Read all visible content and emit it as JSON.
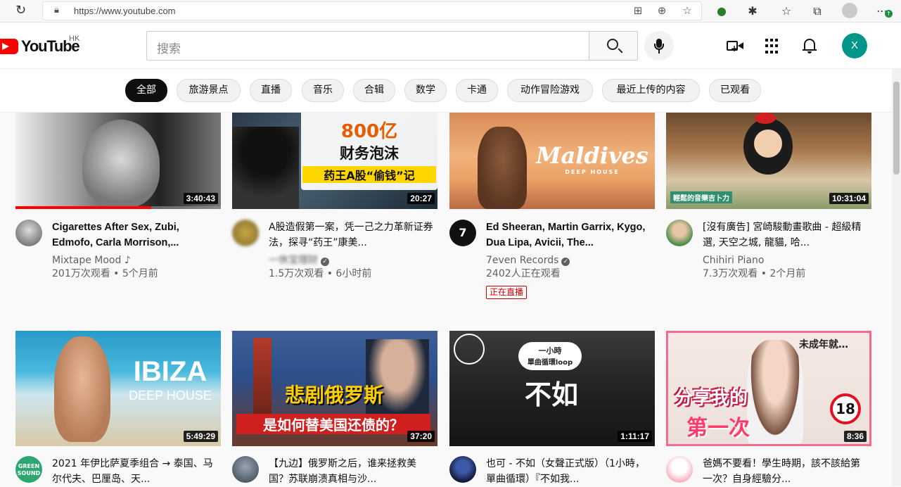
{
  "browser": {
    "url": "https://www.youtube.com"
  },
  "header": {
    "logo_text": "YouTube",
    "region": "HK",
    "search_placeholder": "搜索",
    "avatar_letter": "X"
  },
  "chips": [
    "全部",
    "旅游景点",
    "直播",
    "音乐",
    "合辑",
    "数学",
    "卡通",
    "动作冒险游戏",
    "最近上传的内容",
    "已观看"
  ],
  "colors": {
    "brand_red": "#ff0000",
    "avatar": "#00968a",
    "live": "#cc0000"
  },
  "videos": [
    {
      "title": "Cigarettes After Sex, Zubi, Edmofo, Carla Morrison,...",
      "channel": "Mixtape Mood ♪",
      "meta": "201万次观看 • 5个月前",
      "duration": "3:40:43",
      "watched_fraction": 0.66
    },
    {
      "title": "A股造假第一案，凭一己之力革新证券法，探寻“药王”康美...",
      "channel": "一休宝理财",
      "meta": "1.5万次观看 • 6小时前",
      "duration": "20:27",
      "thumb_lines": [
        "800亿",
        "财务泡沫",
        "药王A股“偷钱”记"
      ]
    },
    {
      "title": "Ed Sheeran, Martin Garrix, Kygo, Dua Lipa, Avicii, The...",
      "channel": "7even Records",
      "meta": "2402人正在观看",
      "live_label": "正在直播",
      "thumb_lines": [
        "Maldives",
        "DEEP HOUSE"
      ]
    },
    {
      "title": "[沒有廣告] 宮崎駿動畫歌曲 - 超級精選, 天空之城, 龍貓, 哈...",
      "channel": "Chihiri Piano",
      "meta": "7.3万次观看 • 2个月前",
      "duration": "10:31:04",
      "thumb_lines": [
        "輕鬆的音樂吉卜力"
      ]
    },
    {
      "title": "2021 年伊比萨夏季组合 → 泰国、马尔代夫、巴厘岛、天...",
      "channel": "",
      "meta": "",
      "duration": "5:49:29",
      "thumb_lines": [
        "IBIZA",
        "DEEP HOUSE"
      ],
      "avatar_text": "GREEN SOUND"
    },
    {
      "title": "【九边】俄罗斯之后，谁来拯救美国？苏联崩溃真相与沙...",
      "channel": "",
      "meta": "",
      "duration": "37:20",
      "thumb_lines": [
        "悲剧俄罗斯",
        "是如何替美国还债的？"
      ]
    },
    {
      "title": "也可 - 不如（女聲正式版）（1小時，單曲循環）『不如我...",
      "channel": "",
      "meta": "",
      "duration": "1:11:17",
      "thumb_lines": [
        "一小時",
        "單曲循環loop",
        "不如"
      ]
    },
    {
      "title": "爸媽不要看！學生時期，該不該給第一次？自身經驗分...",
      "channel": "",
      "meta": "",
      "duration": "8:36",
      "thumb_lines": [
        "未成年就…",
        "分享我的",
        "第一次",
        "18"
      ]
    }
  ]
}
